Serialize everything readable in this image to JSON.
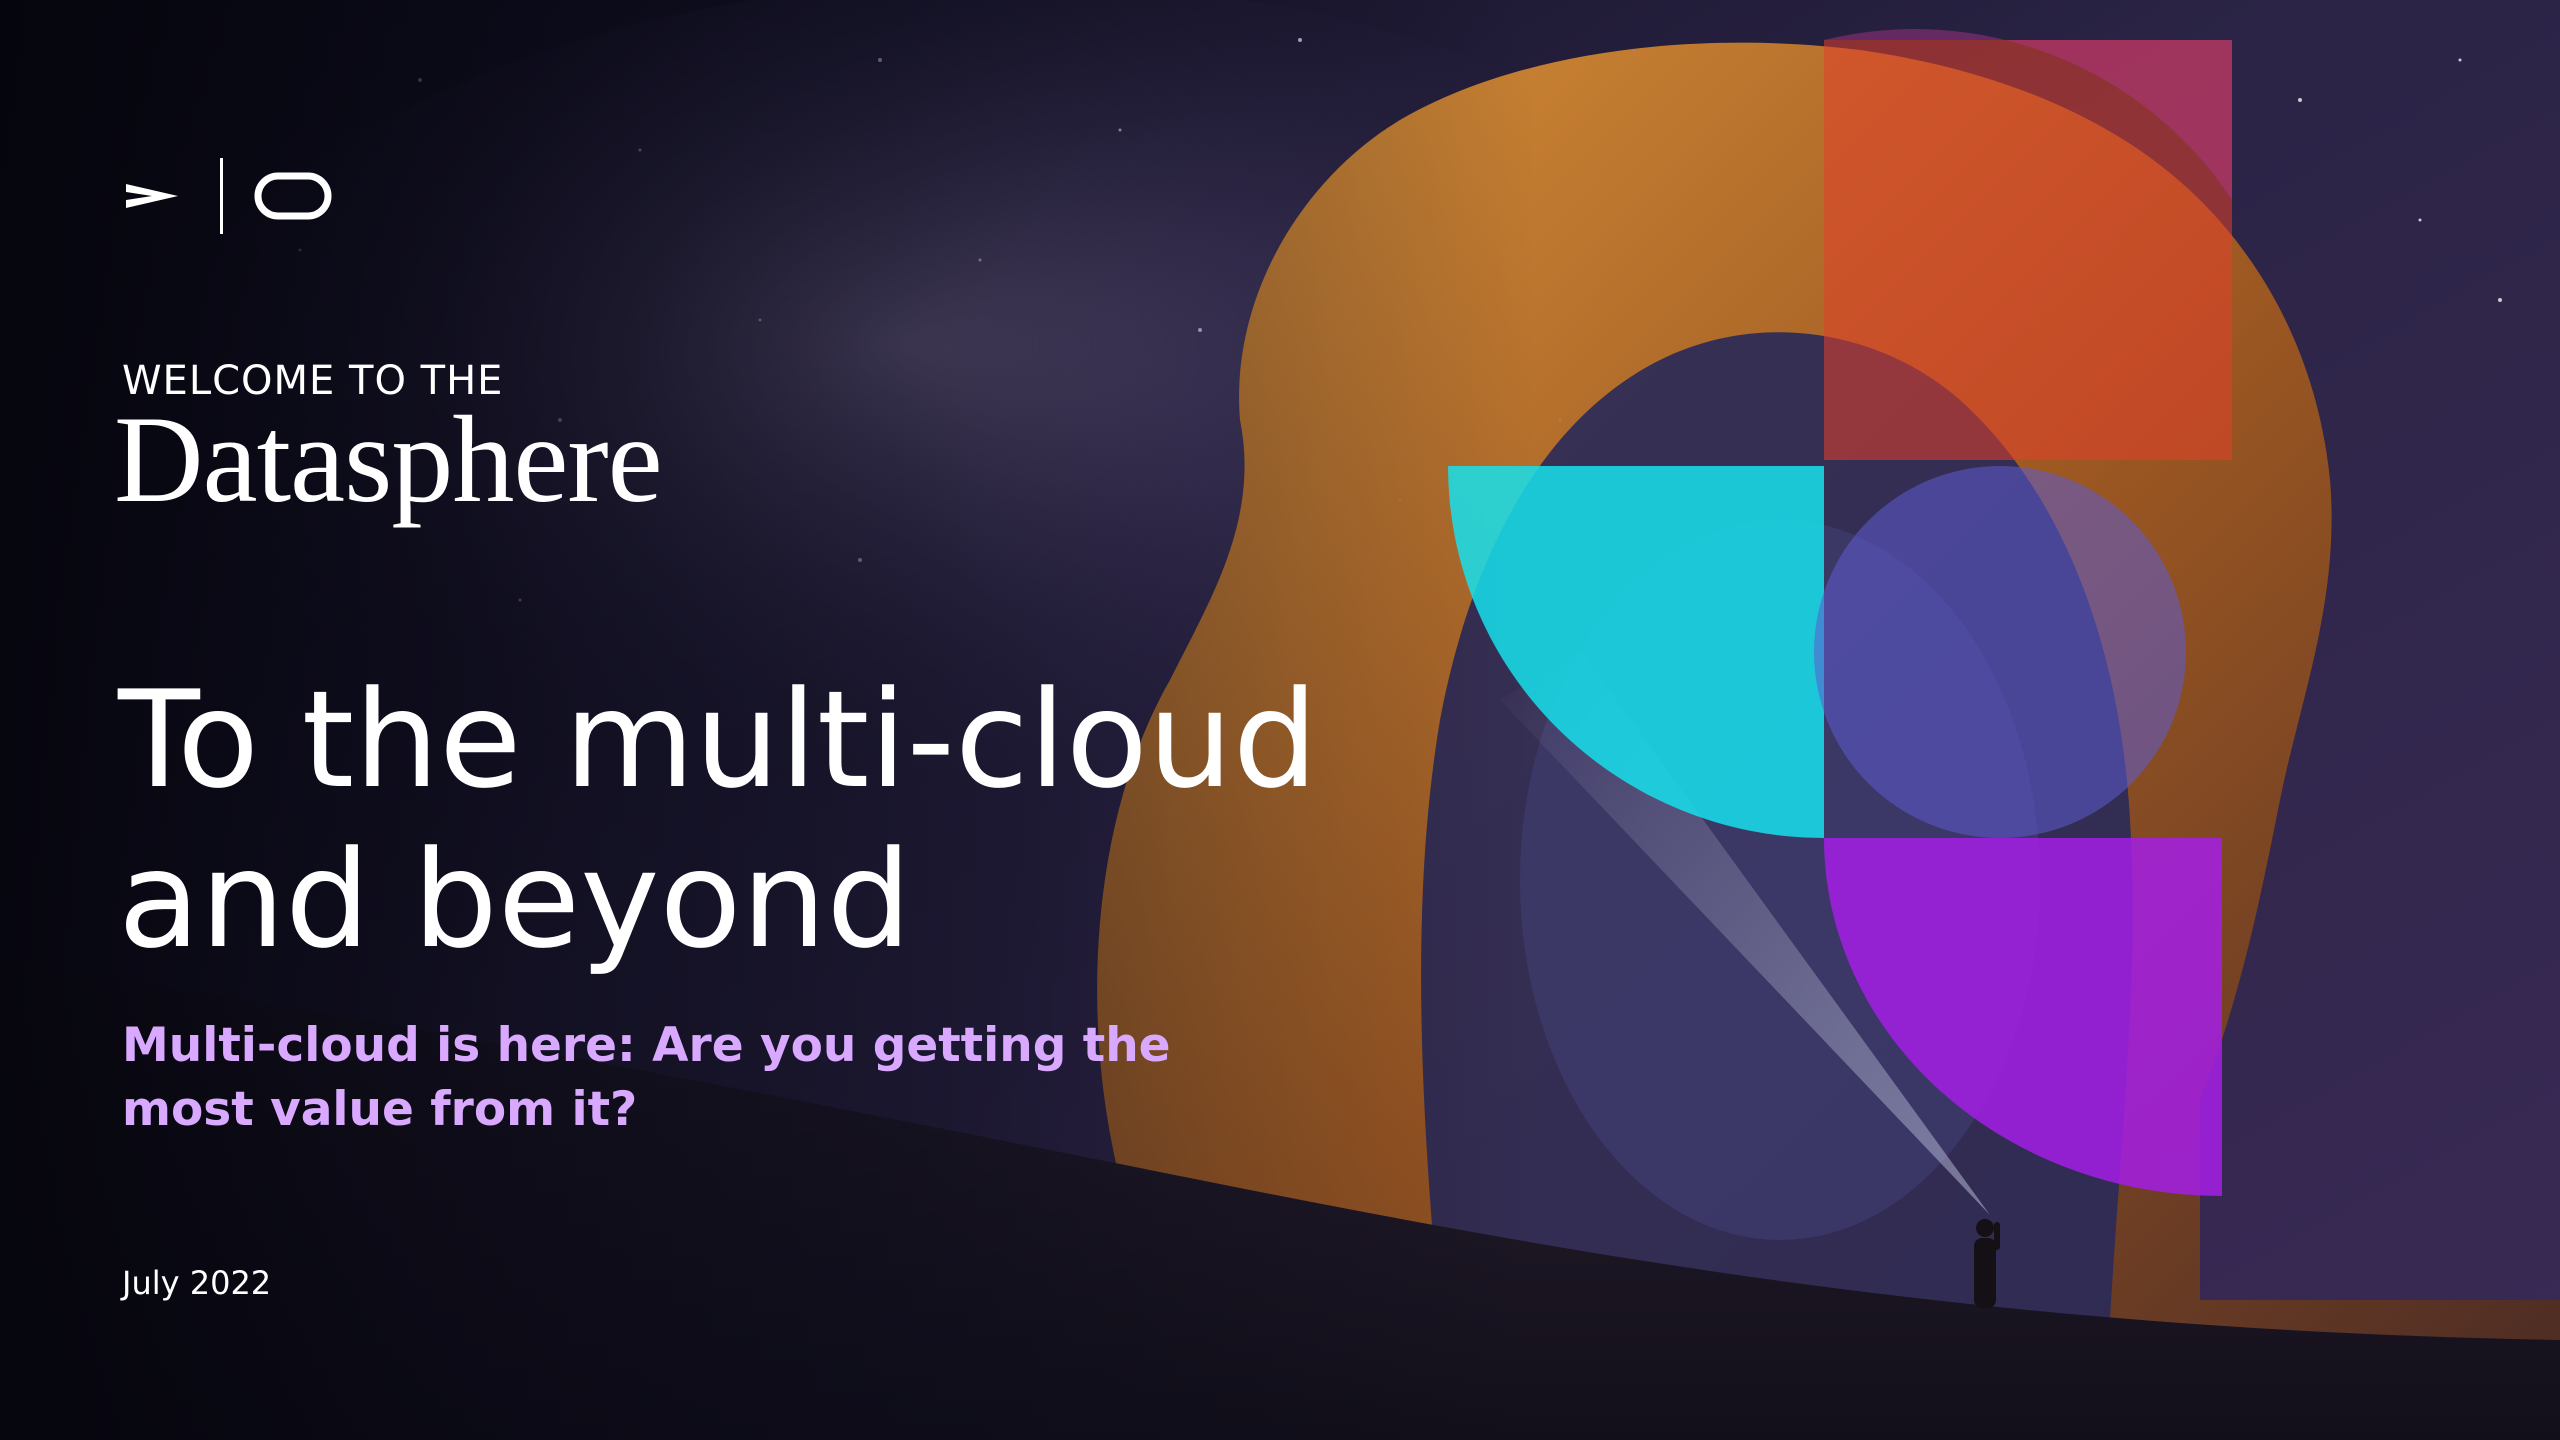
{
  "brand": {
    "logo_icon": "chevron-divider-ring-logo"
  },
  "cover": {
    "kicker": "WELCOME TO THE",
    "wordmark": "Datasphere",
    "headline_line1": "To the multi-cloud",
    "headline_line2": "and beyond",
    "subhead_line1": "Multi-cloud is here: Are you getting the",
    "subhead_line2": "most value from it?",
    "date": "July 2022"
  },
  "colors": {
    "accent_purple": "#d9a8ff",
    "shape_cyan": "#16e0ec",
    "shape_violet": "#a41ee6",
    "shape_orange": "#e2402a",
    "night_sky": "#0c0b1a"
  }
}
